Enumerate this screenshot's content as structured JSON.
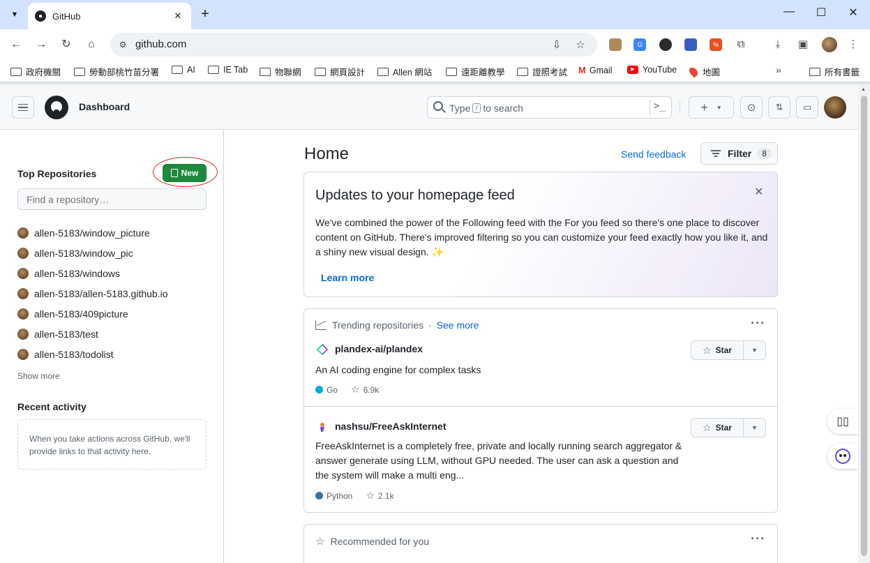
{
  "browser": {
    "tab_title": "GitHub",
    "tab_close": "✕",
    "new_tab": "+",
    "url": "github.com",
    "window_controls": {
      "minimize": "—",
      "maximize": "☐",
      "close": "✕"
    },
    "bookmarks": [
      {
        "label": "政府機關",
        "icon": "folder-icon"
      },
      {
        "label": "勞動部桃竹苗分署",
        "icon": "folder-icon"
      },
      {
        "label": "AI",
        "icon": "folder-icon"
      },
      {
        "label": "IE Tab",
        "icon": "folder-icon"
      },
      {
        "label": "物聯網",
        "icon": "folder-icon"
      },
      {
        "label": "網頁設計",
        "icon": "folder-icon"
      },
      {
        "label": "Allen 網站",
        "icon": "folder-icon"
      },
      {
        "label": "遠距離教學",
        "icon": "folder-icon"
      },
      {
        "label": "證照考試",
        "icon": "folder-icon"
      },
      {
        "label": "Gmail",
        "icon": "gmail-icon"
      },
      {
        "label": "YouTube",
        "icon": "youtube-icon"
      },
      {
        "label": "地圖",
        "icon": "maps-icon"
      }
    ],
    "bookmarks_more": "»",
    "all_bookmarks": "所有書籤"
  },
  "header": {
    "title": "Dashboard",
    "search_placeholder_pre": "Type",
    "search_key": "/",
    "search_placeholder_post": "to search",
    "command_icon": ">_"
  },
  "sidebar": {
    "top_repos_heading": "Top Repositories",
    "new_button": "New",
    "find_placeholder": "Find a repository…",
    "repos": [
      "allen-5183/window_picture",
      "allen-5183/window_pic",
      "allen-5183/windows",
      "allen-5183/allen-5183.github.io",
      "allen-5183/409picture",
      "allen-5183/test",
      "allen-5183/todolist"
    ],
    "show_more": "Show more",
    "recent_heading": "Recent activity",
    "recent_text": "When you take actions across GitHub, we'll provide links to that activity here."
  },
  "main": {
    "title": "Home",
    "send_feedback": "Send feedback",
    "filter_label": "Filter",
    "filter_count": "8",
    "updates": {
      "title": "Updates to your homepage feed",
      "body": "We've combined the power of the Following feed with the For you feed so there's one place to discover content on GitHub. There's improved filtering so you can customize your feed exactly how you like it, and a shiny new visual design. ✨",
      "learn_more": "Learn more"
    },
    "trending": {
      "heading": "Trending repositories",
      "separator": "·",
      "see_more": "See more",
      "items": [
        {
          "name": "plandex-ai/plandex",
          "description": "An AI coding engine for complex tasks",
          "language": "Go",
          "language_color": "#00add8",
          "stars": "6.9k",
          "star_label": "Star"
        },
        {
          "name": "nashsu/FreeAskInternet",
          "description": "FreeAskInternet is a completely free, private and locally running search aggregator & answer generate using LLM, without GPU needed. The user can ask a question and the system will make a multi eng...",
          "language": "Python",
          "language_color": "#3572a5",
          "stars": "2.1k",
          "star_label": "Star"
        }
      ]
    },
    "recommended_heading": "Recommended for you"
  },
  "colors": {
    "accent_link": "#0969da",
    "new_button_green": "#1f883d",
    "annotation_ring": "#e02424"
  }
}
